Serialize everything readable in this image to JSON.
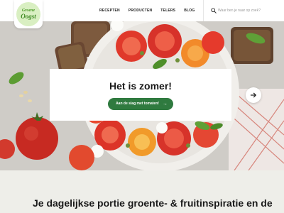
{
  "brand": {
    "logo_top": "Groene",
    "logo_main": "Oogst"
  },
  "nav": {
    "items": [
      {
        "label": "RECEPTEN"
      },
      {
        "label": "PRODUCTEN"
      },
      {
        "label": "TELERS"
      },
      {
        "label": "BLOG"
      }
    ]
  },
  "search": {
    "placeholder": "Waar ben je naar op zoek?",
    "icon": "search-icon"
  },
  "hero": {
    "title": "Het is zomer!",
    "cta_label": "Aan de slag met tomaten!",
    "cta_icon": "arrow-right-icon",
    "next_icon": "arrow-right-icon"
  },
  "intro": {
    "heading": "Je dagelijkse portie groente- & fruitinspiratie en de"
  },
  "colors": {
    "brand_green": "#2f7a3f",
    "logo_green": "#4c9a2a",
    "tomato_red": "#e0392b",
    "intro_bg": "#eeeee9"
  }
}
